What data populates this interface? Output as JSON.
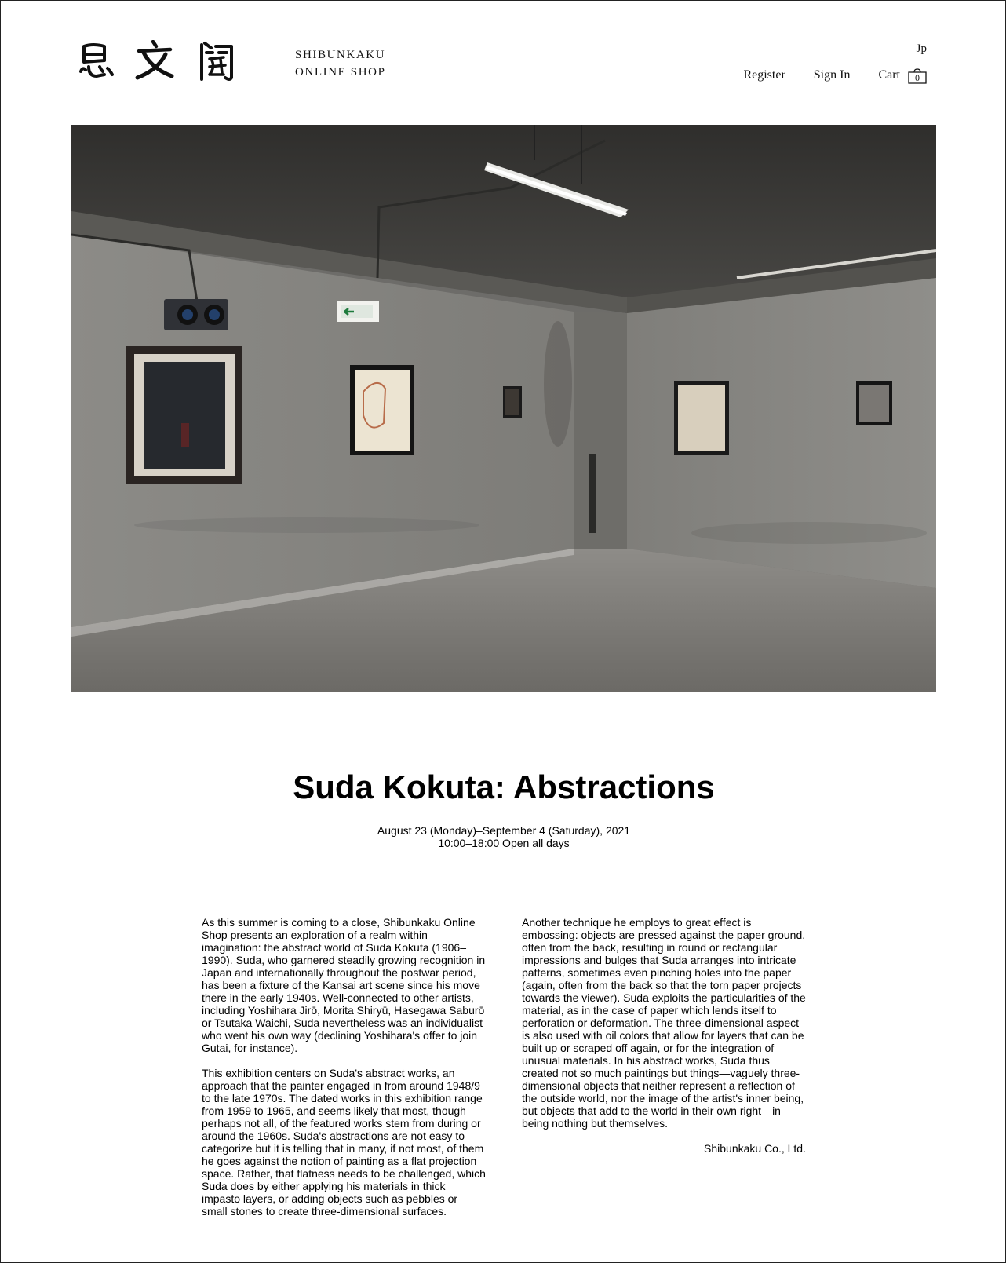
{
  "header": {
    "logo_text": "思文閣",
    "brand_line1": "SHIBUNKAKU",
    "brand_line2": "ONLINE SHOP",
    "lang_label": "Jp",
    "nav": {
      "register": "Register",
      "sign_in": "Sign In",
      "cart": "Cart",
      "cart_count": "0"
    }
  },
  "exhibition": {
    "title": "Suda Kokuta: Abstractions",
    "dates": "August 23 (Monday)–September 4 (Saturday), 2021",
    "hours": "10:00–18:00 Open all days"
  },
  "body": {
    "left_p1": "As this summer is coming to a close, Shibunkaku Online Shop presents an exploration of a realm within imagination: the abstract world of Suda Kokuta (1906–1990). Suda, who garnered steadily growing recognition in Japan and internationally throughout the postwar period, has been a fixture of the Kansai art scene since his move there in the early 1940s. Well-connected to other artists, including Yoshihara Jirō, Morita Shiryū, Hasegawa Saburō or Tsutaka Waichi, Suda nevertheless was an individualist who went his own way (declining Yoshihara's offer to join Gutai, for instance).",
    "left_p2": "This exhibition centers on Suda's abstract works, an approach that the painter engaged in from around 1948/9 to the late 1970s. The dated works in this exhibition range from 1959 to 1965, and seems likely that most, though perhaps not all, of the featured works stem from during or around the 1960s. Suda's abstractions are not easy to categorize but it is telling that in many, if not most, of them he goes against the notion of painting as a flat projection space. Rather, that flatness needs to be challenged, which Suda does by either applying his materials in thick impasto layers, or adding objects such as pebbles or small stones to create three-dimensional surfaces.",
    "right_p1": "Another technique he employs to great effect is embossing: objects are pressed against the paper ground, often from the back, resulting in round or rectangular impressions and bulges that Suda arranges into intricate patterns, sometimes even pinching holes into the paper (again, often from the back so that the torn paper projects towards the viewer). Suda exploits the particularities of the material, as in the case of paper which lends itself to perforation or deformation. The three-dimensional aspect is also used with oil colors that allow for layers that can be built up or scraped off again, or for the integration of unusual materials. In his abstract works, Suda thus created not so much paintings but things—vaguely three-dimensional objects that neither represent a reflection of the outside world, nor the image of the artist's inner being, but objects that add to the world in their own right—in being nothing but themselves.",
    "signoff": "Shibunkaku Co., Ltd."
  },
  "colors": {
    "text": "#111111",
    "background": "#ffffff",
    "gallery_wall": "#8a8985",
    "gallery_ceiling": "#3f3e3b"
  }
}
